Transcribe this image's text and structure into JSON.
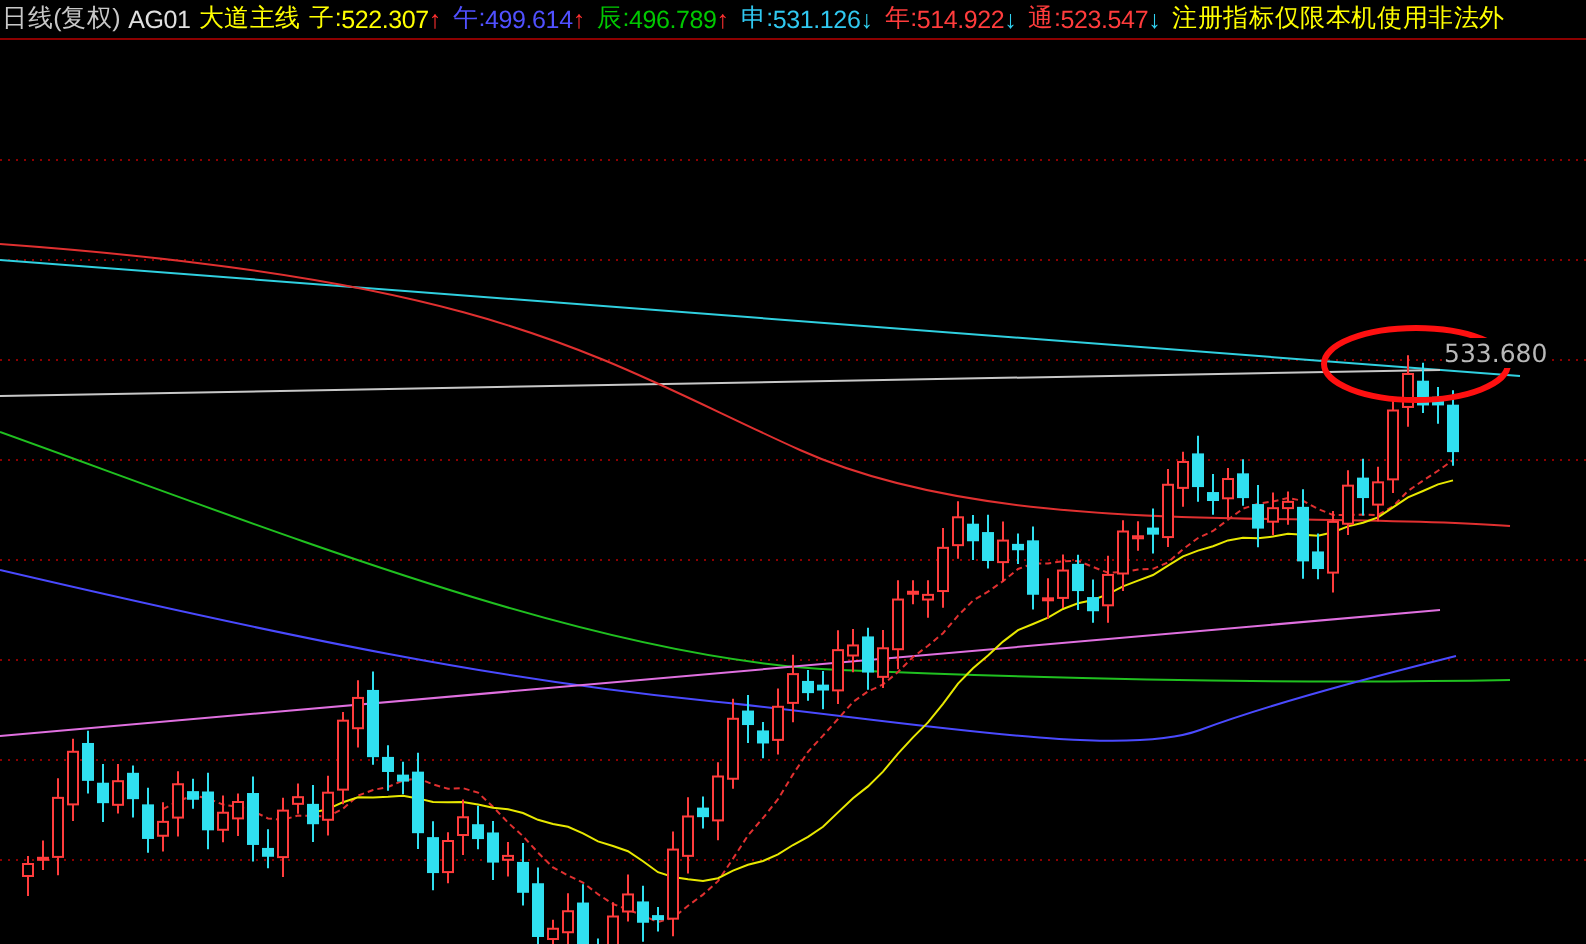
{
  "header": {
    "period": "日线(复权)",
    "symbol": "AG01",
    "indicator": "大道主线",
    "lines": [
      {
        "label": "子:",
        "value": "522.307",
        "arrow": "↑",
        "kind": "rise",
        "color": "#ffff00"
      },
      {
        "label": "午:",
        "value": "499.614",
        "arrow": "↑",
        "kind": "rise",
        "color": "#5050ff"
      },
      {
        "label": "辰:",
        "value": "496.789",
        "arrow": "↑",
        "kind": "rise",
        "color": "#00c800"
      },
      {
        "label": "申:",
        "value": "531.126",
        "arrow": "↓",
        "kind": "fall",
        "color": "#30c8f0"
      },
      {
        "label": "年:",
        "value": "514.922",
        "arrow": "↓",
        "kind": "fall",
        "color": "#ff3c3c"
      },
      {
        "label": "通:",
        "value": "523.547",
        "arrow": "↓",
        "kind": "fall",
        "color": "#ff3c3c"
      }
    ],
    "notice": "注册指标仅限本机使用非法外"
  },
  "chart": {
    "price_label": "533.680"
  }
}
